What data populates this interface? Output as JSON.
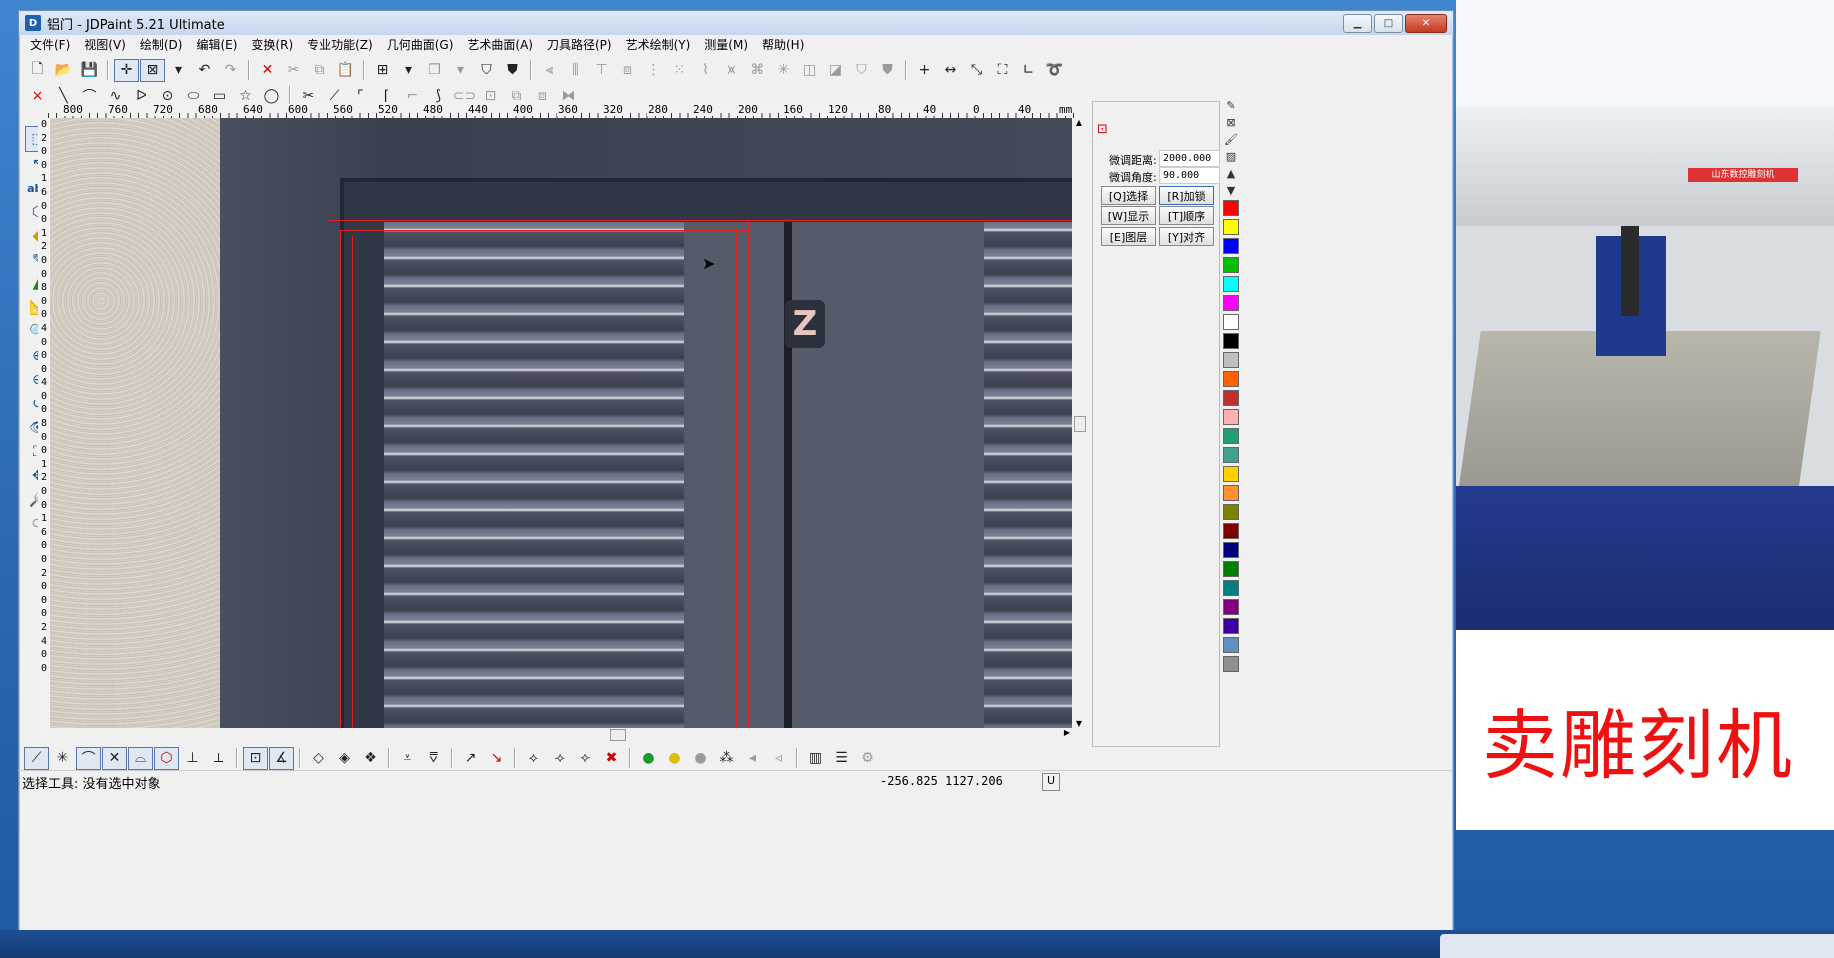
{
  "window": {
    "title": "铝门 - JDPaint 5.21 Ultimate",
    "app_icon": "jdpaint-icon",
    "buttons": {
      "minimize": "minimize-icon",
      "maximize": "maximize-icon",
      "close": "close-icon"
    }
  },
  "menu": [
    "文件(F)",
    "视图(V)",
    "绘制(D)",
    "编辑(E)",
    "变换(R)",
    "专业功能(Z)",
    "几何曲面(G)",
    "艺术曲面(A)",
    "刀具路径(P)",
    "艺术绘制(Y)",
    "测量(M)",
    "帮助(H)"
  ],
  "ruler": {
    "labels": [
      "800",
      "760",
      "720",
      "680",
      "640",
      "600",
      "560",
      "520",
      "480",
      "440",
      "400",
      "360",
      "320",
      "280",
      "240",
      "200",
      "160",
      "120",
      "80",
      "40",
      "0",
      "40"
    ],
    "unit": "mm",
    "vertical_digits": [
      "0",
      "2",
      "0",
      "0",
      "1",
      "6",
      "0",
      "0",
      "1",
      "2",
      "0",
      "0",
      "8",
      "0",
      "0",
      "4",
      "0",
      "0",
      "0",
      "4",
      "0",
      "0",
      "8",
      "0",
      "0",
      "1",
      "2",
      "0",
      "0",
      "1",
      "6",
      "0",
      "0",
      "2",
      "0",
      "0",
      "0",
      "2",
      "4",
      "0",
      "0"
    ]
  },
  "props": {
    "dist_label": "微调距离:",
    "dist_value": "2000.000",
    "angle_label": "微调角度:",
    "angle_value": "90.000",
    "btn_select": "[Q]选择",
    "btn_lock": "[R]加锁",
    "btn_show": "[W]显示",
    "btn_order": "[T]顺序",
    "btn_layer": "[E]图层",
    "btn_align": "[Y]对齐"
  },
  "palette": [
    "#ff0000",
    "#ffff00",
    "#0000ff",
    "#00c000",
    "#00ffff",
    "#ff00ff",
    "#ffffff",
    "#000000",
    "#c0c0c0",
    "#ff6000",
    "#c03030",
    "#ffb0b0",
    "#20a070",
    "#40a090",
    "#ffd000",
    "#ff9030",
    "#808000",
    "#800000",
    "#000080",
    "#008000",
    "#008080",
    "#800080",
    "#4000a0",
    "#6090c0",
    "#909090"
  ],
  "canvas": {
    "logo_text": "Z"
  },
  "status": {
    "tool_text": "选择工具: 没有选中对象",
    "coords": "-256.825  1127.206",
    "unit_badge": "U"
  },
  "video": {
    "caption": "卖雕刻机",
    "banner": "山东数控雕刻机"
  }
}
